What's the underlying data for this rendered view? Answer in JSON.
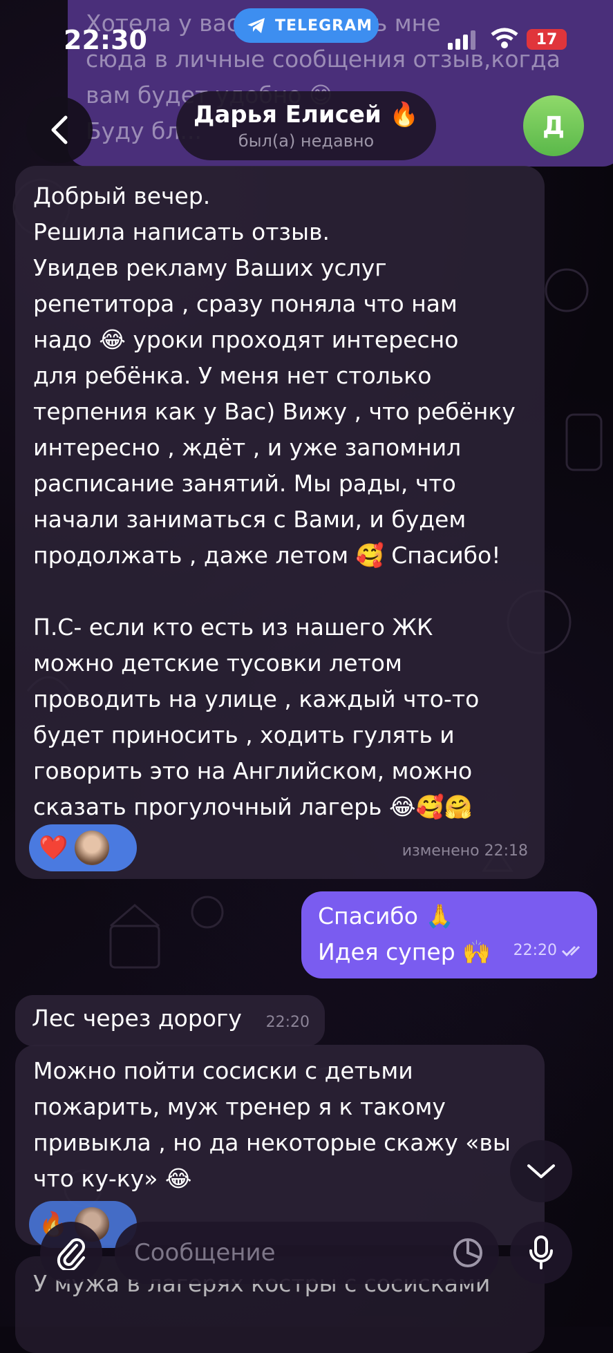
{
  "status_bar": {
    "time": "22:30",
    "app_pill": "TELEGRAM",
    "battery": "17"
  },
  "header": {
    "contact_name": "Дарья Елисей 🔥",
    "contact_status": "был(а) недавно",
    "avatar_letter": "Д"
  },
  "previous_message": {
    "lines": [
      "Хотела у вас ... написать мне",
      "сюда в личные сообщения отзыв,когда",
      "вам будет удобно 😊",
      "Буду бл..."
    ]
  },
  "messages": [
    {
      "direction": "incoming",
      "lines": [
        "Добрый вечер.",
        "Решила написать отзыв.",
        "Увидев рекламу Ваших  услуг",
        "репетитора , сразу поняла что нам",
        "надо 😂 уроки проходят интересно",
        "для ребёнка. У меня нет столько",
        "терпения как у Вас) Вижу , что ребёнку",
        "интересно , ждёт , и уже запомнил",
        "расписание занятий. Мы рады, что",
        "начали заниматься с Вами, и будем",
        "продолжать , даже летом 🥰 Спасибо!",
        "",
        "П.С- если кто есть из нашего ЖК",
        "можно детские тусовки летом",
        "проводить на улице , каждый что-то",
        "будет приносить , ходить гулять и",
        "говорить это на Английском, можно",
        "сказать прогулочный лагерь 😂🥰🤗"
      ],
      "reaction": "❤️",
      "meta": "изменено 22:18"
    },
    {
      "direction": "outgoing",
      "lines": [
        "Спасибо 🙏",
        "Идея супер 🙌"
      ],
      "time": "22:20"
    },
    {
      "direction": "incoming",
      "lines": [
        "Лес через дорогу"
      ],
      "time": "22:20"
    },
    {
      "direction": "incoming",
      "lines": [
        "Можно пойти сосиски с детьми",
        "пожарить, муж тренер я к такому",
        "привыкла , но да некоторые скажу «вы",
        "что ку-ку» 😂"
      ],
      "reaction": "🔥"
    },
    {
      "direction": "incoming",
      "lines": [
        "У мужа в лагерях костры с сосисками"
      ]
    }
  ],
  "input": {
    "placeholder": "Сообщение"
  },
  "colors": {
    "outgoing_bubble": "#7a5cf0",
    "incoming_bubble": "#2d2337",
    "reaction_pill": "#4a7ae0",
    "telegram_blue": "#3d8ef0"
  }
}
